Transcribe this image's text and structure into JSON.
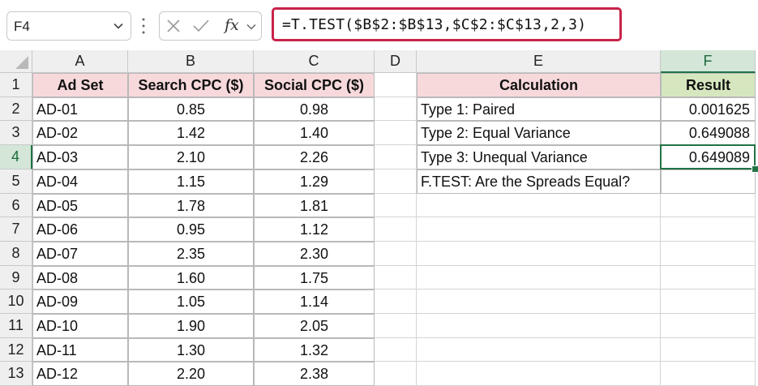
{
  "formula_bar": {
    "name_box": "F4",
    "formula": "=T.TEST($B$2:$B$13,$C$2:$C$13,2,3)",
    "fx_label": "fx"
  },
  "columns": [
    "A",
    "B",
    "C",
    "D",
    "E",
    "F"
  ],
  "rows": [
    "1",
    "2",
    "3",
    "4",
    "5",
    "6",
    "7",
    "8",
    "9",
    "10",
    "11",
    "12",
    "13"
  ],
  "headers": {
    "ad_set": "Ad Set",
    "search_cpc": "Search CPC ($)",
    "social_cpc": "Social CPC ($)",
    "calculation": "Calculation",
    "result": "Result"
  },
  "data_rows": [
    {
      "ad_set": "AD-01",
      "search": "0.85",
      "social": "0.98"
    },
    {
      "ad_set": "AD-02",
      "search": "1.42",
      "social": "1.40"
    },
    {
      "ad_set": "AD-03",
      "search": "2.10",
      "social": "2.26"
    },
    {
      "ad_set": "AD-04",
      "search": "1.15",
      "social": "1.29"
    },
    {
      "ad_set": "AD-05",
      "search": "1.78",
      "social": "1.81"
    },
    {
      "ad_set": "AD-06",
      "search": "0.95",
      "social": "1.12"
    },
    {
      "ad_set": "AD-07",
      "search": "2.35",
      "social": "2.30"
    },
    {
      "ad_set": "AD-08",
      "search": "1.60",
      "social": "1.75"
    },
    {
      "ad_set": "AD-09",
      "search": "1.05",
      "social": "1.14"
    },
    {
      "ad_set": "AD-10",
      "search": "1.90",
      "social": "2.05"
    },
    {
      "ad_set": "AD-11",
      "search": "1.30",
      "social": "1.32"
    },
    {
      "ad_set": "AD-12",
      "search": "2.20",
      "social": "2.38"
    }
  ],
  "calc_rows": [
    {
      "label": "Type 1: Paired",
      "result": "0.001625"
    },
    {
      "label": "Type 2: Equal Variance",
      "result": "0.649088"
    },
    {
      "label": "Type 3: Unequal Variance",
      "result": "0.649089"
    },
    {
      "label": "F.TEST: Are the Spreads Equal?",
      "result": ""
    }
  ],
  "active_cell": {
    "column": "F",
    "row": "4"
  },
  "colors": {
    "accent_green": "#217346",
    "formula_highlight": "#c8234a",
    "header_pink": "#f7d9dc",
    "header_green": "#d6e7bf"
  },
  "icons": {
    "name_box_dropdown": "chevron-down-icon",
    "cancel": "x-icon",
    "enter": "checkmark-icon",
    "insert_function": "fx-icon",
    "fx_dropdown": "chevron-down-icon"
  }
}
